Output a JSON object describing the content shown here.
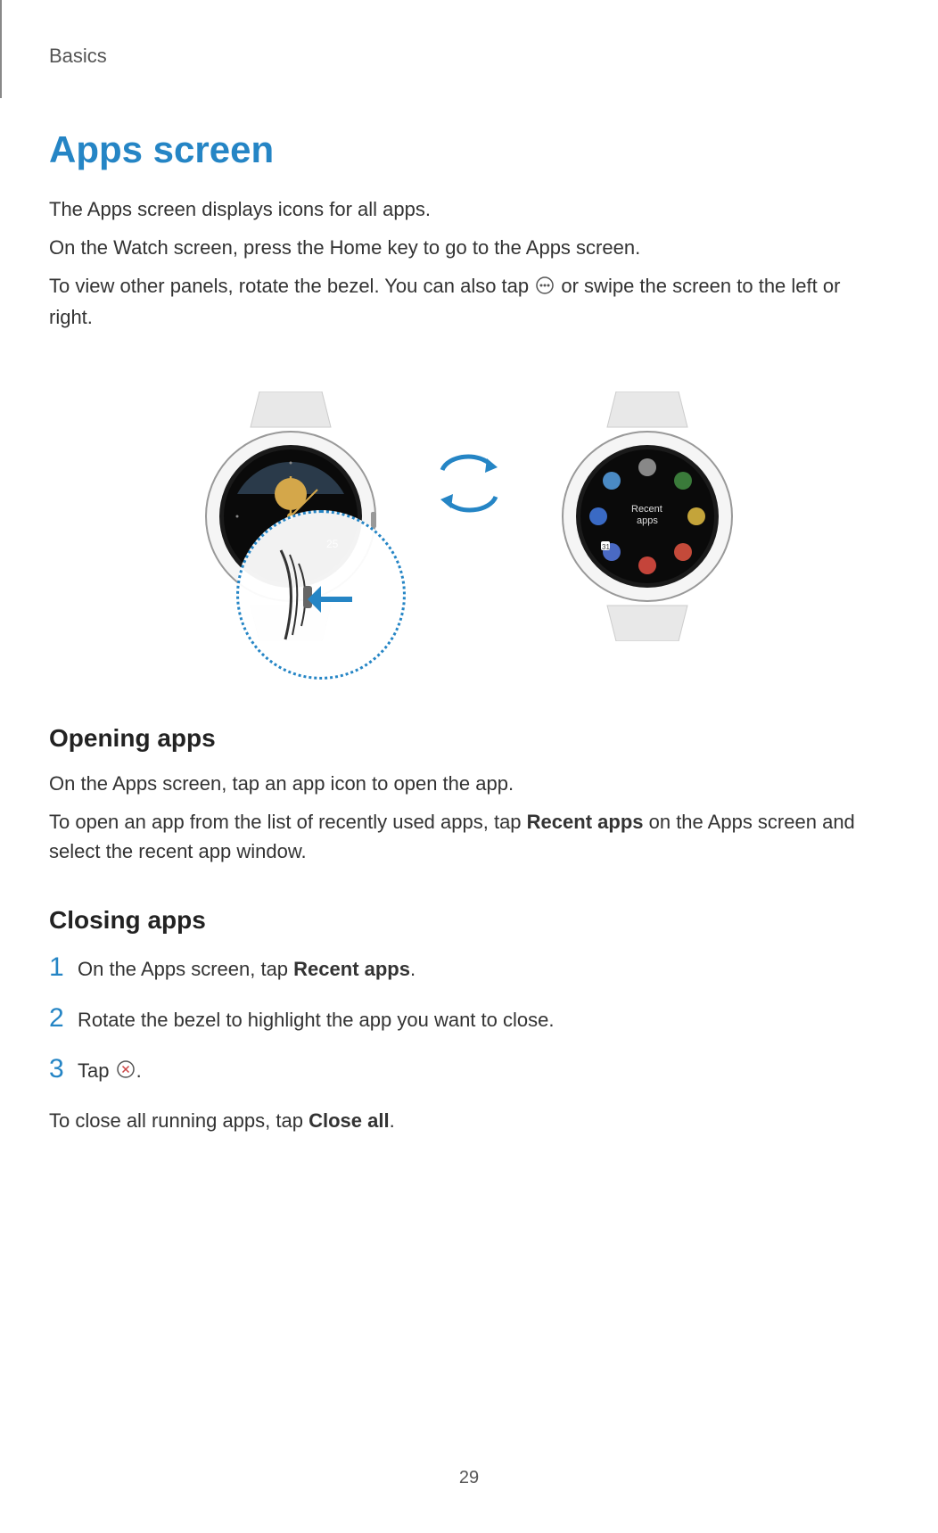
{
  "breadcrumb": "Basics",
  "page_title": "Apps screen",
  "intro": {
    "line1": "The Apps screen displays icons for all apps.",
    "line2": "On the Watch screen, press the Home key to go to the Apps screen.",
    "line3_before": "To view other panels, rotate the bezel. You can also tap ",
    "line3_after": " or swipe the screen to the left or right."
  },
  "sections": {
    "opening": {
      "heading": "Opening apps",
      "p1": "On the Apps screen, tap an app icon to open the app.",
      "p2_before": "To open an app from the list of recently used apps, tap ",
      "p2_bold": "Recent apps",
      "p2_after": " on the Apps screen and select the recent app window."
    },
    "closing": {
      "heading": "Closing apps",
      "steps": {
        "1": {
          "num": "1",
          "before": "On the Apps screen, tap ",
          "bold": "Recent apps",
          "after": "."
        },
        "2": {
          "num": "2",
          "text": "Rotate the bezel to highlight the app you want to close."
        },
        "3": {
          "num": "3",
          "before": "Tap ",
          "after": "."
        }
      },
      "footer_before": "To close all running apps, tap ",
      "footer_bold": "Close all",
      "footer_after": "."
    }
  },
  "watch_right_label": "Recent apps",
  "page_number": "29"
}
